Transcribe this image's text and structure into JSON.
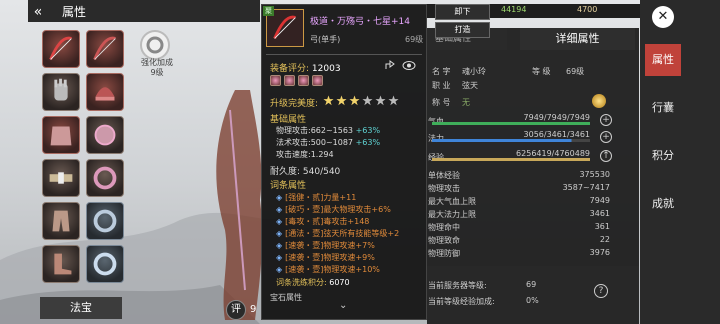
{
  "left_panel": {
    "title": "属性",
    "enhance_label_line1": "强化加成",
    "enhance_label_line2": "9级",
    "fabao": "法宝",
    "score_badge": "评",
    "score_peek": "9"
  },
  "tooltip": {
    "grade_tag": "聚",
    "name": "极道・万殇弓・七星+14",
    "type": "弓(单手)",
    "level": "69级",
    "score_label": "装备评分:",
    "score_value": "12003",
    "perfection_label": "升级完美度:",
    "stars_filled": 3,
    "stars_total": 6,
    "base_title": "基础属性",
    "stats": [
      {
        "label": "物理攻击:",
        "value": "662~1563",
        "bonus": "+63%"
      },
      {
        "label": "法术攻击:",
        "value": "500~1087",
        "bonus": "+63%"
      },
      {
        "label": "攻击速度:",
        "value": "1.294",
        "bonus": ""
      }
    ],
    "durability": "耐久度: 540/540",
    "affix_title": "词条属性",
    "affixes": [
      "[强健・贰]力量+11",
      "[破巧・壹]最大物理攻击+6%",
      "[毒攻・贰]毒攻击+148",
      "[通法・壹]弦天所有技能等级+2",
      "[速袭・壹]物理攻速+7%",
      "[速袭・壹]物理攻速+9%",
      "[速袭・壹]物理攻速+10%"
    ],
    "wash_label": "词条洗练积分:",
    "wash_value": "6070",
    "cut_text": "宝石属性"
  },
  "top_bar": {
    "currency_1": "44194",
    "currency_2": "4700",
    "unequip": "卸下",
    "forge": "打造"
  },
  "right_panel": {
    "tab_left": "基础属性",
    "tab_detail": "详细属性",
    "name_label": "名 字",
    "name_value": "魂小玲",
    "level_label": "等 级",
    "level_value": "69级",
    "job_label": "职 业",
    "job_value": "弦天",
    "title_label": "称 号",
    "title_value": "无",
    "hp_label": "气血",
    "hp_value": "7949/7949/7949",
    "mp_label": "法力",
    "mp_value": "3056/3461/3461",
    "exp_label": "经验",
    "exp_value": "6256419/4760489",
    "details": [
      {
        "label": "单体经验",
        "value": "375530"
      },
      {
        "label": "物理攻击",
        "value": "3587~7417"
      },
      {
        "label": "最大气血上限",
        "value": "7949"
      },
      {
        "label": "最大法力上限",
        "value": "3461"
      },
      {
        "label": "物理命中",
        "value": "361"
      },
      {
        "label": "物理致命",
        "value": "22"
      },
      {
        "label": "物理防御",
        "value": "3976"
      }
    ],
    "server_level_label": "当前服务器等级:",
    "server_level_value": "69",
    "exp_bonus_label": "当前等级经验加成:",
    "exp_bonus_value": "0%"
  },
  "side_nav": {
    "items": [
      "属性",
      "行囊",
      "积分",
      "成就"
    ],
    "active": "属性"
  },
  "colors": {
    "hp_bar": "#3fae5a",
    "mp_bar": "#3f84d8",
    "exp_bar": "#c8a85a",
    "accent_gold": "#e3c15a",
    "active_nav": "#c0423a"
  }
}
